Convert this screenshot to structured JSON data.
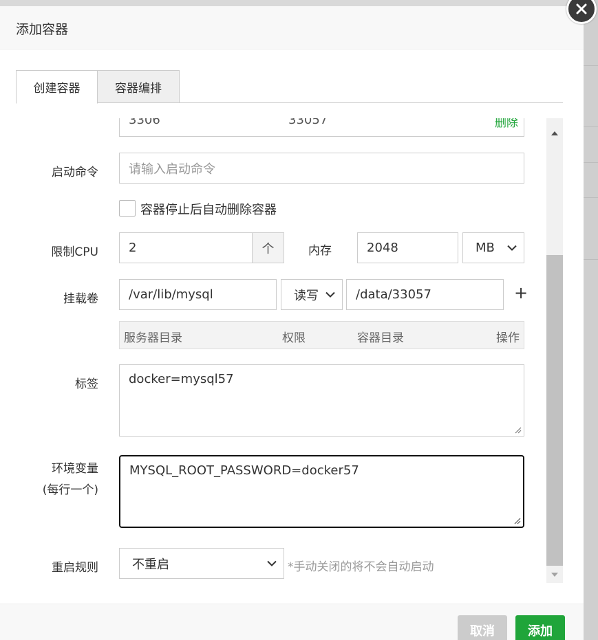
{
  "dialog": {
    "title": "添加容器"
  },
  "tabs": [
    {
      "label": "创建容器",
      "active": true
    },
    {
      "label": "容器编排",
      "active": false
    }
  ],
  "port_row": {
    "host_port": "3306",
    "container_port": "33057",
    "delete_label": "删除"
  },
  "form": {
    "start_cmd": {
      "label": "启动命令",
      "placeholder": "请输入启动命令",
      "value": ""
    },
    "auto_remove": {
      "label": "容器停止后自动删除容器",
      "checked": false
    },
    "cpu": {
      "label": "限制CPU",
      "value": "2",
      "unit": "个"
    },
    "memory": {
      "label": "内存",
      "value": "2048",
      "unit": "MB"
    },
    "volume": {
      "label": "挂载卷",
      "host_dir": "/var/lib/mysql",
      "permission": "读写",
      "container_dir": "/data/33057",
      "add_icon": "+",
      "table_headers": [
        "服务器目录",
        "权限",
        "容器目录",
        "操作"
      ]
    },
    "tags": {
      "label": "标签",
      "value": "docker=mysql57"
    },
    "env": {
      "label": "环境变量",
      "sublabel": "(每行一个)",
      "value": "MYSQL_ROOT_PASSWORD=docker57"
    },
    "restart": {
      "label": "重启规则",
      "value": "不重启",
      "hint": "*手动关闭的将不会自动启动"
    }
  },
  "footer": {
    "cancel_label": "取消",
    "add_label": "添加"
  },
  "colors": {
    "accent": "#20a53a",
    "cancel": "#cccccc",
    "header_bg": "#f8f8f8"
  }
}
